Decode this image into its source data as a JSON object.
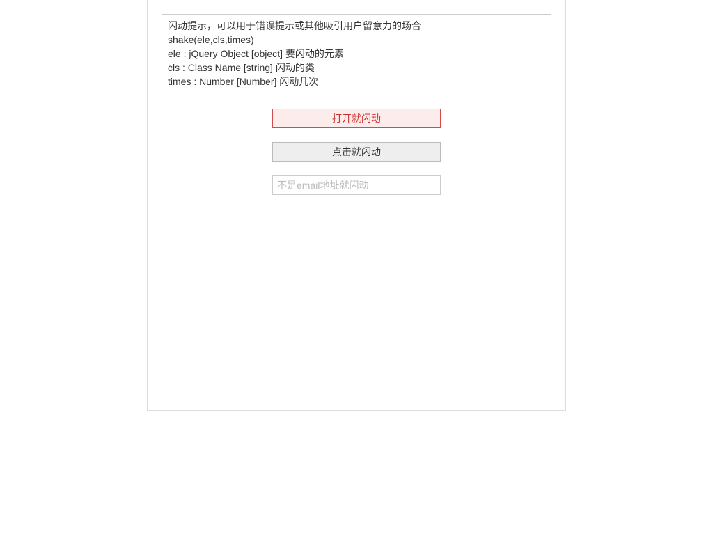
{
  "desc": {
    "line1": "闪动提示，可以用于错误提示或其他吸引用户留意力的场合",
    "line2": "shake(ele,cls,times)",
    "line3": "ele : jQuery Object [object] 要闪动的元素",
    "line4": "cls : Class Name [string] 闪动的类",
    "line5": "times : Number [Number] 闪动几次"
  },
  "controls": {
    "open_button_label": "打开就闪动",
    "click_button_label": "点击就闪动",
    "email_placeholder": "不是email地址就闪动"
  },
  "colors": {
    "error_border": "#d34b4b",
    "error_bg": "#fdecec",
    "error_text": "#c9302c",
    "default_bg": "#eeeeee",
    "border": "#ccc"
  }
}
